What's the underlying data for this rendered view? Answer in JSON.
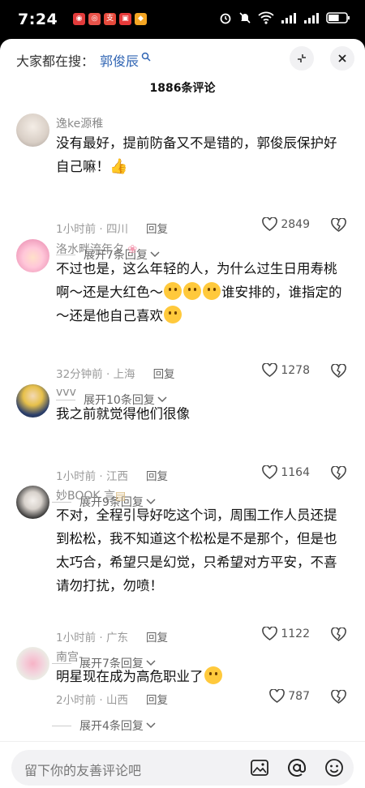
{
  "status_bar": {
    "time": "7:24",
    "app_icons": [
      {
        "name": "app-icon-1",
        "color": "#e23b3b",
        "glyph": "◉"
      },
      {
        "name": "app-icon-2",
        "color": "#e8534a",
        "glyph": "◎"
      },
      {
        "name": "app-icon-3",
        "color": "#e64a3c",
        "glyph": "支"
      },
      {
        "name": "app-icon-4",
        "color": "#e63a3a",
        "glyph": "▣"
      },
      {
        "name": "app-icon-5",
        "color": "#f5a623",
        "glyph": "◆"
      }
    ],
    "battery_level": 0.6
  },
  "header": {
    "search_prefix": "大家都在搜：",
    "search_term": "郭俊辰",
    "comment_count_title": "1886条评论"
  },
  "comments": [
    {
      "username": "逸ke源稚",
      "lines": [
        "没有最好，提前防备又不是错的，郭俊辰保护好",
        "自己嘛！"
      ],
      "time": "1小时前",
      "location": "四川",
      "reply_label": "回复",
      "likes": "2849",
      "expand_label": "展开7条回复"
    },
    {
      "username": "洛水畔流年夕",
      "lines": [
        "不过也是，这么年轻的人，为什么过生日用寿桃",
        "啊～还是大红色～",
        "谁安排的，谁指定的",
        "～还是他自己喜欢"
      ],
      "time": "32分钟前",
      "location": "上海",
      "reply_label": "回复",
      "likes": "1278",
      "expand_label": "展开10条回复"
    },
    {
      "username": "vvv",
      "lines": [
        "我之前就觉得他们很像"
      ],
      "time": "1小时前",
      "location": "江西",
      "reply_label": "回复",
      "likes": "1164",
      "expand_label": "展开9条回复"
    },
    {
      "username": "妙BOOK",
      "user_badge": "言",
      "lines": [
        "不对，全程引导好吃这个词，周围工作人员还提",
        "到松松，我不知道这个松松是不是那个，但是也",
        "太巧合，希望只是幻觉，只希望对方平安，不喜",
        "请勿打扰，勿喷！"
      ],
      "time": "1小时前",
      "location": "广东",
      "reply_label": "回复",
      "likes": "1122",
      "expand_label": "展开7条回复"
    },
    {
      "username": "南宫-",
      "lines": [
        "明星现在成为高危职业了"
      ],
      "time": "2小时前",
      "location": "山西",
      "reply_label": "回复",
      "likes": "787",
      "expand_label": "展开4条回复"
    }
  ],
  "bottom_bar": {
    "input_placeholder": "留下你的友善评论吧",
    "icons": [
      "image-icon",
      "at-icon",
      "emoji-icon"
    ]
  }
}
